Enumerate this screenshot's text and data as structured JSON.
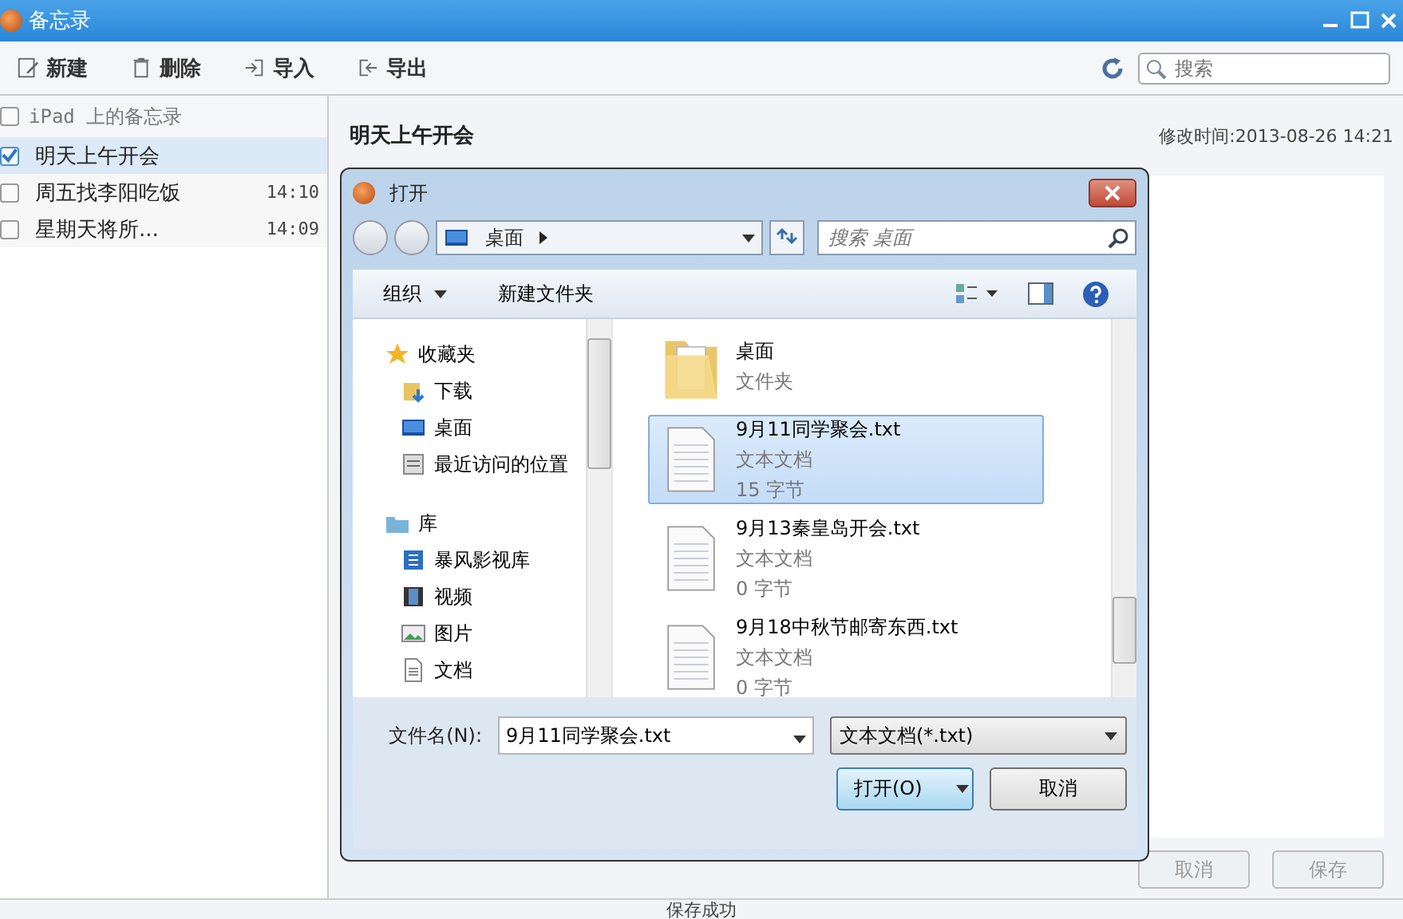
{
  "window": {
    "title": "备忘录"
  },
  "toolbar": [
    {
      "kind": "new",
      "label": "新建"
    },
    {
      "kind": "delete",
      "label": "删除"
    },
    {
      "kind": "import",
      "label": "导入"
    },
    {
      "kind": "export",
      "label": "导出"
    }
  ],
  "search": {
    "placeholder": "搜索"
  },
  "sidebar": {
    "header": {
      "label": "iPad 上的备忘录",
      "checked": false
    },
    "notes": [
      {
        "title": "明天上午开会",
        "checked": true,
        "selected": true
      },
      {
        "title": "周五找李阳吃饭",
        "time": "14:10",
        "checked": false,
        "selected": false
      },
      {
        "title": "星期天将所...",
        "time": "14:09",
        "checked": false,
        "selected": false
      }
    ]
  },
  "note": {
    "title": "明天上午开会",
    "modified": "修改时间:2013-08-26 14:21"
  },
  "dialog": {
    "title": "打开",
    "path": "桌面",
    "search_placeholder": "搜索 桌面",
    "commands": [
      {
        "label": "组织",
        "dropdown": true
      },
      {
        "label": "新建文件夹",
        "dropdown": false
      }
    ],
    "nav": [
      {
        "label": "收藏夹",
        "kind": "star",
        "children": [
          {
            "label": "下载",
            "kind": "download"
          },
          {
            "label": "桌面",
            "kind": "desktop"
          },
          {
            "label": "最近访问的位置",
            "kind": "recent"
          }
        ]
      },
      {
        "label": "库",
        "kind": "library",
        "children": [
          {
            "label": "暴风影视库",
            "kind": "media"
          },
          {
            "label": "视频",
            "kind": "video"
          },
          {
            "label": "图片",
            "kind": "picture"
          },
          {
            "label": "文档",
            "kind": "document"
          }
        ]
      }
    ],
    "files": [
      {
        "kind": "folder",
        "name": "桌面",
        "type": "文件夹",
        "selected": false
      },
      {
        "kind": "text",
        "name": "9月11同学聚会.txt",
        "type": "文本文档",
        "size": "15 字节",
        "selected": true
      },
      {
        "kind": "text",
        "name": "9月13秦皇岛开会.txt",
        "type": "文本文档",
        "size": "0 字节",
        "selected": false
      },
      {
        "kind": "text",
        "name": "9月18中秋节邮寄东西.txt",
        "type": "文本文档",
        "size": "0 字节",
        "selected": false
      }
    ],
    "filename_label": "文件名(N):",
    "filename": "9月11同学聚会.txt",
    "filter": "文本文档(*.txt)",
    "open_button": "打开(O)",
    "cancel_button": "取消"
  },
  "footer_buttons": [
    "取消",
    "保存"
  ],
  "status": "保存成功"
}
